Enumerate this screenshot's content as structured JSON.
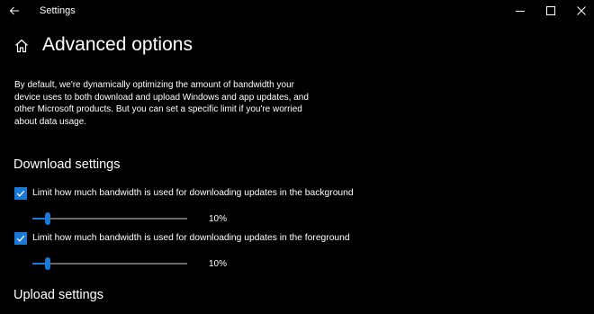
{
  "window": {
    "app_title": "Settings"
  },
  "header": {
    "title": "Advanced options"
  },
  "description": "By default, we're dynamically optimizing the amount of bandwidth your device uses to both download and upload Windows and app updates, and other Microsoft products. But you can set a specific limit if you're worried about data usage.",
  "download_settings": {
    "heading": "Download settings",
    "background": {
      "label": "Limit how much bandwidth is used for downloading updates in the background",
      "checked": true,
      "value": 10,
      "value_label": "10%"
    },
    "foreground": {
      "label": "Limit how much bandwidth is used for downloading updates in the foreground",
      "checked": true,
      "value": 10,
      "value_label": "10%"
    }
  },
  "upload_settings": {
    "heading": "Upload settings"
  },
  "colors": {
    "accent": "#1b78d6",
    "background": "#000000",
    "text": "#ffffff",
    "track": "#666666"
  }
}
